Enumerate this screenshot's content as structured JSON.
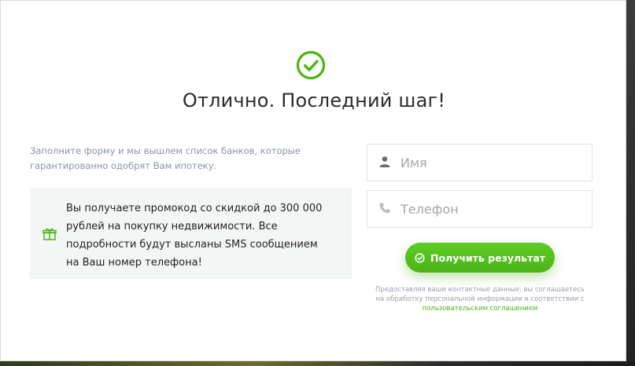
{
  "modal": {
    "title": "Отлично. Последний шаг!",
    "subtitle": "Заполните форму и мы вышлем список банков, которые гарантированно одобрят Вам ипотеку.",
    "icons": {
      "success": "check-circle-icon",
      "gift": "gift-icon",
      "user": "user-icon",
      "phone": "phone-icon",
      "button": "check-circle-icon"
    }
  },
  "promo": {
    "text": "Вы получаете промокод со скидкой до 300 000 рублей на покупку недвижимости. Все подробности будут высланы SMS сообщением на Ваш номер телефона!"
  },
  "form": {
    "name_placeholder": "Имя",
    "phone_placeholder": "Телефон",
    "submit_label": "Получить результат"
  },
  "consent": {
    "text": "Предоставляя ваши контактные данные, вы соглашаетесь на обработку персональной информации в соответствии с",
    "link": "пользовательским соглашением"
  },
  "colors": {
    "accent": "#4ab516",
    "text": "#2b2b2b",
    "muted": "#8a93a6"
  }
}
